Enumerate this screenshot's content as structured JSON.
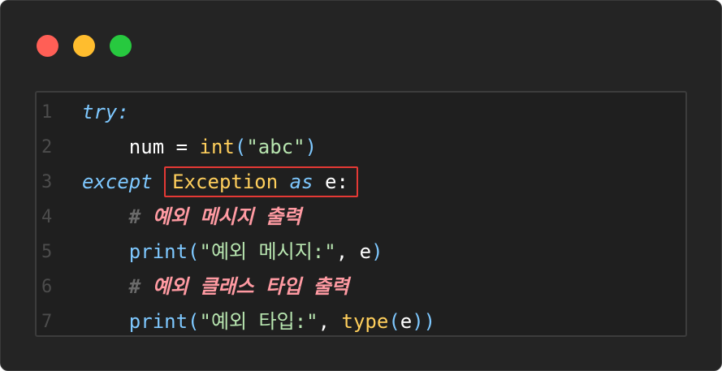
{
  "window": {
    "traffic_lights": {
      "close_color": "#ff5f56",
      "minimize_color": "#ffbd2e",
      "maximize_color": "#27c93f"
    }
  },
  "colors": {
    "keyword": "#7ec8ff",
    "identifier": "#ffffff",
    "builtin": "#ffcf5c",
    "string": "#b8e6b0",
    "paren": "#7ec8ff",
    "comment_hash": "#6a6a6a",
    "comment_text": "#ff9aa2",
    "highlight_border": "#e53935"
  },
  "code": {
    "lines": [
      {
        "num": "1",
        "tokens": [
          {
            "text": "try",
            "kind": "keyword"
          },
          {
            "text": ":",
            "kind": "keyword"
          }
        ]
      },
      {
        "num": "2",
        "tokens": [
          {
            "text": "    num = ",
            "kind": "identifier"
          },
          {
            "text": "int",
            "kind": "builtin"
          },
          {
            "text": "(",
            "kind": "paren"
          },
          {
            "text": "\"abc\"",
            "kind": "string"
          },
          {
            "text": ")",
            "kind": "paren"
          }
        ]
      },
      {
        "num": "3",
        "tokens": [
          {
            "text": "except",
            "kind": "keyword"
          },
          {
            "text": " ",
            "kind": "identifier"
          },
          {
            "text": "Exception",
            "kind": "builtin",
            "highlight_start": true
          },
          {
            "text": " ",
            "kind": "identifier"
          },
          {
            "text": "as",
            "kind": "keyword"
          },
          {
            "text": " e:",
            "kind": "identifier",
            "highlight_end": true
          }
        ]
      },
      {
        "num": "4",
        "tokens": [
          {
            "text": "    ",
            "kind": "identifier"
          },
          {
            "text": "# ",
            "kind": "comment_hash"
          },
          {
            "text": "예외 메시지 출력",
            "kind": "comment_text"
          }
        ]
      },
      {
        "num": "5",
        "tokens": [
          {
            "text": "    ",
            "kind": "identifier"
          },
          {
            "text": "print",
            "kind": "keyword_plain"
          },
          {
            "text": "(",
            "kind": "paren"
          },
          {
            "text": "\"예외 메시지:\"",
            "kind": "string"
          },
          {
            "text": ", e",
            "kind": "identifier"
          },
          {
            "text": ")",
            "kind": "paren"
          }
        ]
      },
      {
        "num": "6",
        "tokens": [
          {
            "text": "    ",
            "kind": "identifier"
          },
          {
            "text": "# ",
            "kind": "comment_hash"
          },
          {
            "text": "예외 클래스 타입 출력",
            "kind": "comment_text"
          }
        ]
      },
      {
        "num": "7",
        "tokens": [
          {
            "text": "    ",
            "kind": "identifier"
          },
          {
            "text": "print",
            "kind": "keyword_plain"
          },
          {
            "text": "(",
            "kind": "paren"
          },
          {
            "text": "\"예외 타입:\"",
            "kind": "string"
          },
          {
            "text": ", ",
            "kind": "identifier"
          },
          {
            "text": "type",
            "kind": "builtin"
          },
          {
            "text": "(",
            "kind": "paren"
          },
          {
            "text": "e",
            "kind": "identifier"
          },
          {
            "text": "))",
            "kind": "paren"
          }
        ]
      }
    ]
  }
}
